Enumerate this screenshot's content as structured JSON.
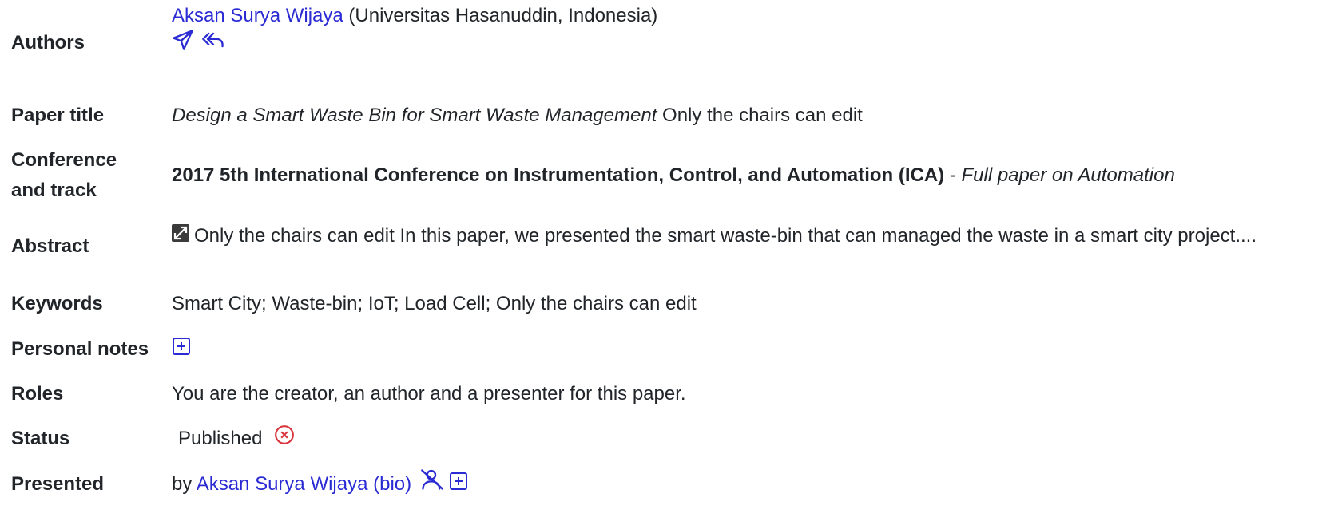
{
  "authors": {
    "label": "Authors",
    "name": "Aksan Surya Wijaya",
    "affiliation": "(Universitas Hasanuddin, Indonesia)",
    "icons": [
      "send-icon",
      "reply-all-icon"
    ]
  },
  "paper_title": {
    "label": "Paper title",
    "title": "Design a Smart Waste Bin for Smart Waste Management",
    "note": "Only the chairs can edit"
  },
  "conference": {
    "label_line1": "Conference",
    "label_line2": "and track",
    "name": "2017 5th International Conference on Instrumentation, Control, and Automation (ICA)",
    "separator": "-",
    "track": "Full paper on Automation"
  },
  "abstract": {
    "label": "Abstract",
    "icon": "expand-icon",
    "note": "Only the chairs can edit",
    "text": "In this paper, we presented the smart waste-bin that can managed the waste in a smart city project...."
  },
  "keywords": {
    "label": "Keywords",
    "value": "Smart City; Waste-bin; IoT; Load Cell;",
    "note": "Only the chairs can edit"
  },
  "personal_notes": {
    "label": "Personal notes",
    "icon": "plus-square-icon"
  },
  "roles": {
    "label": "Roles",
    "value": "You are the creator, an author and a presenter for this paper."
  },
  "status": {
    "label": "Status",
    "value": "Published",
    "icon": "x-circle-icon",
    "icon_color": "#d9363e"
  },
  "presented": {
    "label": "Presented",
    "prefix": "by",
    "presenter": "Aksan Surya Wijaya (bio)",
    "icons": [
      "person-remove-icon",
      "plus-square-icon"
    ]
  },
  "colors": {
    "link": "#2b2bd4",
    "text": "#212529",
    "danger": "#d9363e"
  }
}
